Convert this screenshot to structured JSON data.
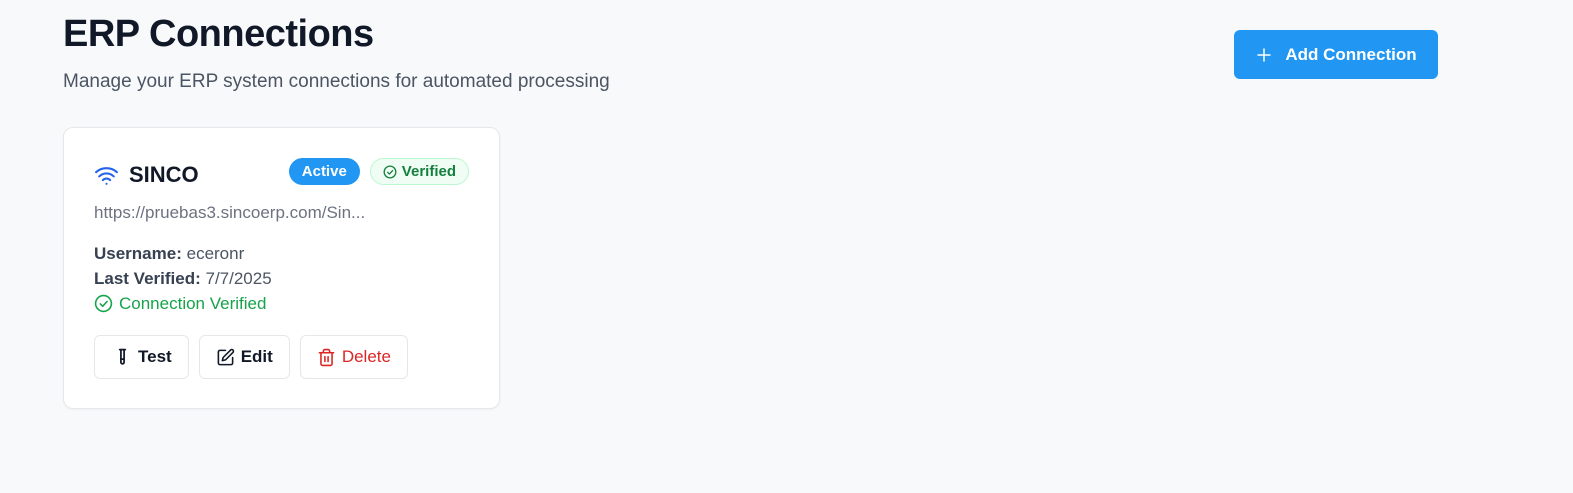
{
  "header": {
    "title": "ERP Connections",
    "subtitle": "Manage your ERP system connections for automated processing",
    "add_button_label": "Add Connection",
    "add_icon": "plus-icon"
  },
  "connections": [
    {
      "name": "SINCO",
      "icon": "wifi-icon",
      "status_badge": "Active",
      "verified_badge": "Verified",
      "url": "https://pruebas3.sincoerp.com/Sin...",
      "username_label": "Username:",
      "username": "eceronr",
      "last_verified_label": "Last Verified:",
      "last_verified": "7/7/2025",
      "status_text": "Connection Verified",
      "actions": {
        "test": "Test",
        "edit": "Edit",
        "delete": "Delete"
      }
    }
  ],
  "colors": {
    "primary": "#2196f3",
    "success": "#16a34a",
    "danger": "#dc2626",
    "background": "#f8f9fb"
  }
}
